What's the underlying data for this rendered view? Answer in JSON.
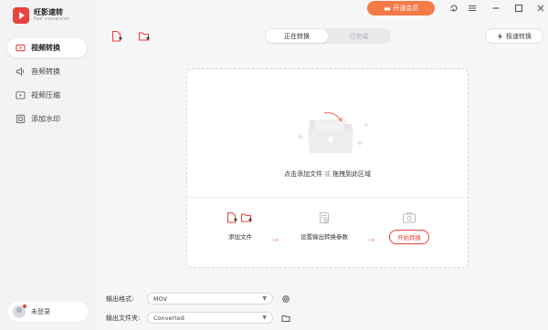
{
  "app": {
    "name": "旺影速转",
    "subtitle": "Fast conversion"
  },
  "sidebar": {
    "items": [
      {
        "label": "视频转换",
        "icon": "video-convert-icon",
        "active": true
      },
      {
        "label": "音频转换",
        "icon": "audio-icon",
        "active": false
      },
      {
        "label": "视频压缩",
        "icon": "compress-icon",
        "active": false
      },
      {
        "label": "添加水印",
        "icon": "watermark-icon",
        "active": false
      }
    ],
    "login_label": "未登录"
  },
  "titlebar": {
    "vip_label": "开通会员"
  },
  "tabs": [
    {
      "label": "正在转换",
      "active": true
    },
    {
      "label": "已完成",
      "active": false
    }
  ],
  "fast_convert_label": "极速转换",
  "dropzone": {
    "text_main": "点击添加文件",
    "text_or": "或",
    "text_drag": "拖拽到此区域"
  },
  "steps": [
    {
      "label": "添加文件"
    },
    {
      "label": "设置输出转换参数"
    },
    {
      "label": "开始转换"
    }
  ],
  "settings": {
    "format_label": "输出格式:",
    "format_value": "MOV",
    "folder_label": "输出文件夹:",
    "folder_value": "Converted"
  },
  "colors": {
    "accent": "#e8433e",
    "vip": "#f47a46",
    "arrow": "#f3a08b"
  }
}
